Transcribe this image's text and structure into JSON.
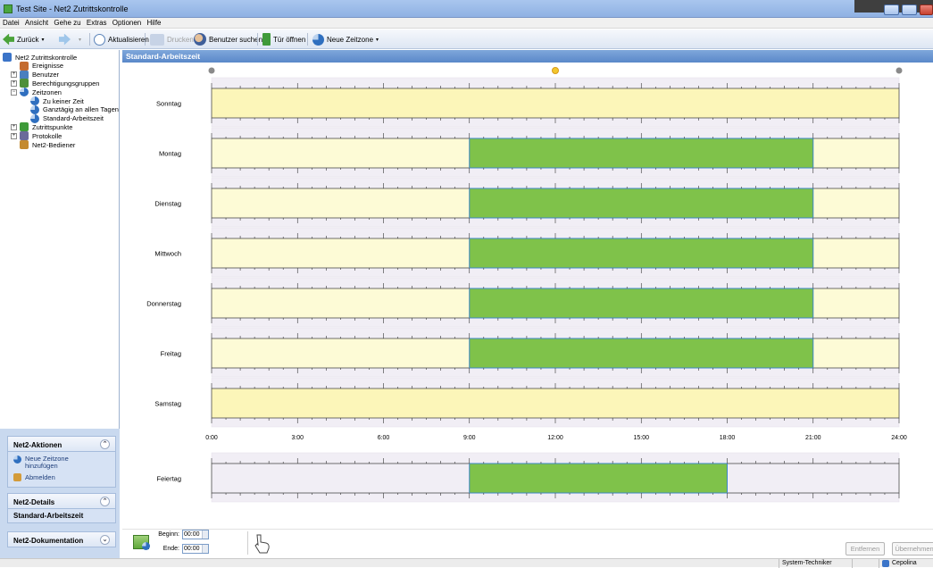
{
  "window": {
    "title": "Test Site - Net2 Zutrittskontrolle"
  },
  "menu": [
    "Datei",
    "Ansicht",
    "Gehe zu",
    "Extras",
    "Optionen",
    "Hilfe"
  ],
  "toolbar": {
    "back": "Zurück",
    "refresh": "Aktualisieren",
    "print": "Drucken",
    "find_user": "Benutzer suchen",
    "open_door": "Tür öffnen",
    "new_timezone": "Neue Zeitzone"
  },
  "tree": [
    {
      "label": "Net2 Zutrittskontrolle",
      "level": 0,
      "icon": "network-icon",
      "color": "#3b74c8"
    },
    {
      "label": "Ereignisse",
      "level": 1,
      "icon": "events-icon",
      "color": "#c46a2e"
    },
    {
      "label": "Benutzer",
      "level": 1,
      "icon": "users-icon",
      "color": "#4a7fbf",
      "expander": "+"
    },
    {
      "label": "Berechtigungsgruppen",
      "level": 1,
      "icon": "groups-icon",
      "color": "#4e8f3a",
      "expander": "+"
    },
    {
      "label": "Zeitzonen",
      "level": 1,
      "icon": "clock-icon",
      "color": "#2f6fbf",
      "expander": "−"
    },
    {
      "label": "Zu keiner Zeit",
      "level": 2,
      "icon": "clock-icon",
      "color": "#2f6fbf"
    },
    {
      "label": "Ganztägig an allen Tagen",
      "level": 2,
      "icon": "clock-icon",
      "color": "#2f6fbf"
    },
    {
      "label": "Standard-Arbeitszeit",
      "level": 2,
      "icon": "clock-icon",
      "color": "#2f6fbf"
    },
    {
      "label": "Zutrittspunkte",
      "level": 1,
      "icon": "door-icon",
      "color": "#3f9a3a",
      "expander": "+"
    },
    {
      "label": "Protokolle",
      "level": 1,
      "icon": "report-icon",
      "color": "#6a6a9a",
      "expander": "+"
    },
    {
      "label": "Net2-Bediener",
      "level": 1,
      "icon": "operator-icon",
      "color": "#c48a2e"
    }
  ],
  "tasks": {
    "actions_title": "Net2-Aktionen",
    "action_new_timezone": "Neue Zeitzone hinzufügen",
    "action_logout": "Abmelden",
    "details_title": "Net2-Details",
    "details_value": "Standard-Arbeitszeit",
    "docs_title": "Net2-Dokumentation"
  },
  "main": {
    "header": "Standard-Arbeitszeit",
    "time_axis": [
      "0:00",
      "3:00",
      "6:00",
      "9:00",
      "12:00",
      "15:00",
      "18:00",
      "21:00",
      "24:00"
    ],
    "days": [
      {
        "name": "Sonntag",
        "start": null,
        "end": null
      },
      {
        "name": "Montag",
        "start": 9,
        "end": 21
      },
      {
        "name": "Dienstag",
        "start": 9,
        "end": 21
      },
      {
        "name": "Mittwoch",
        "start": 9,
        "end": 21
      },
      {
        "name": "Donnerstag",
        "start": 9,
        "end": 21
      },
      {
        "name": "Freitag",
        "start": 9,
        "end": 21
      },
      {
        "name": "Samstag",
        "start": null,
        "end": null
      }
    ],
    "holiday": {
      "name": "Feiertag",
      "start": 9,
      "end": 18
    }
  },
  "editor": {
    "begin_label": "Beginn:",
    "begin_value": "00:00",
    "end_label": "Ende:",
    "end_value": "00:00",
    "remove": "Entfernen",
    "apply": "Übernehmen"
  },
  "status": {
    "role": "System-Techniker",
    "user": "Cepolina"
  },
  "colors": {
    "active": "#7fc24a",
    "inactive_bg": "#fdfbd6",
    "weekend_bg": "#fcf6b9",
    "lane_bg": "#f1eef5",
    "header_blue": "#5a88c9"
  }
}
